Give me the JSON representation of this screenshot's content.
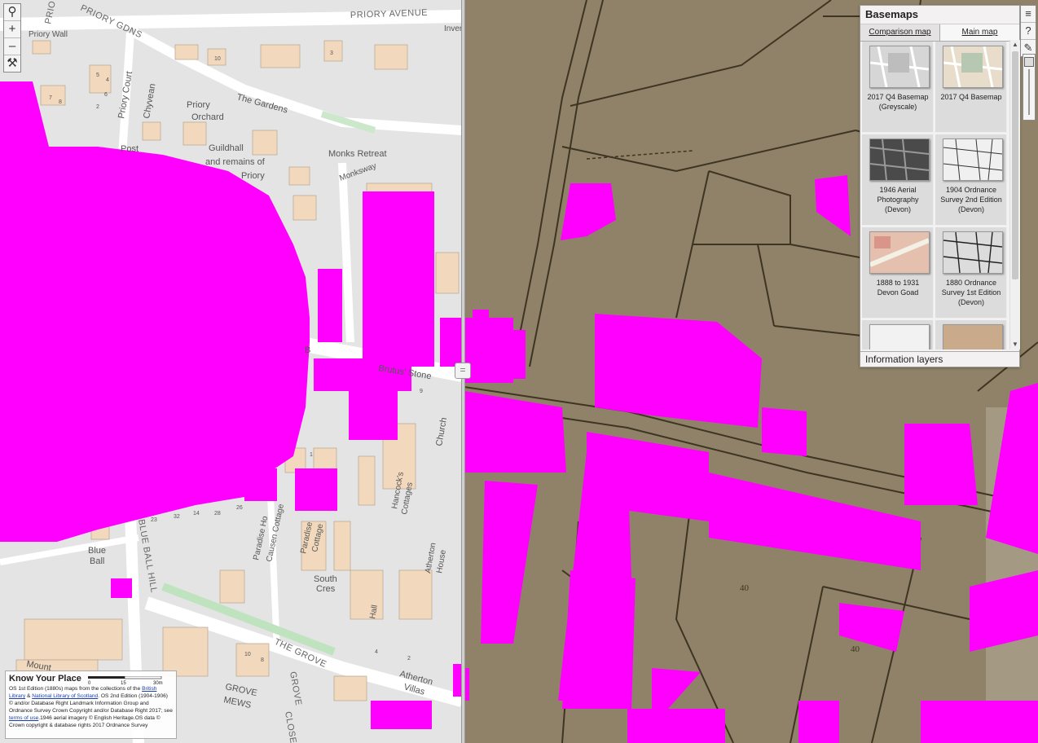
{
  "map_labels": {
    "priory_avenue": "PRIORY AVENUE",
    "priory_gdns": "PRIORY GDNS",
    "priory_corner": "PRIO",
    "priory_wall": "Priory Wall",
    "priory_court": "Priory Court",
    "chyvean": "Chyvean",
    "priory_orchard_1": "Priory",
    "priory_orchard_2": "Orchard",
    "the_gardens": "The Gardens",
    "post": "Post",
    "guildhall": "Guildhall",
    "remains": "and remains of",
    "priory": "Priory",
    "monks_retreat": "Monks Retreat",
    "monksway": "Monksway",
    "inver": "Inver",
    "brutus_stone": "Brutus' Stone",
    "b": "B",
    "church": "Church",
    "hancocks": "Hancock's",
    "cottages": "Cottages",
    "paradise_ho": "Paradise Ho",
    "causen_cottage": "Causen Cottage",
    "paradise": "Paradise",
    "cottage": "Cottage",
    "atherton": "Atherton",
    "house": "House",
    "blue": "Blue",
    "ball": "Ball",
    "blue_ball_hill": "BLUE BALL HILL",
    "south": "South",
    "cres": "Cres",
    "hall": "Hall",
    "the_grove": "THE GROVE",
    "grove": "GROVE",
    "mews": "MEWS",
    "grove_close_1": "GROVE",
    "grove_close_2": "CLOSE",
    "atherton_villas_1": "Atherton",
    "atherton_villas_2": "Villas",
    "mount": "Mount",
    "house_numbers": [
      "10",
      "3",
      "5",
      "7",
      "2",
      "4",
      "6",
      "8",
      "1",
      "9",
      "14",
      "28",
      "26",
      "23",
      "32",
      "4",
      "2",
      "10",
      "8"
    ],
    "old_map_40": "40",
    "old_map_40b": "40"
  },
  "toolbar": {
    "zoom_search_icon": "⚲",
    "zoom_in": "+",
    "zoom_out": "–",
    "measure_icon": "⚒"
  },
  "divider": {
    "handle_glyph": "="
  },
  "right_toolbar": {
    "layers_icon": "≡",
    "help_icon": "?",
    "draw_icon": "✎"
  },
  "basemaps": {
    "title": "Basemaps",
    "tabs": [
      {
        "label": "Comparison map",
        "active": true
      },
      {
        "label": "Main map",
        "active": false
      }
    ],
    "thumbs": [
      {
        "label": "2017 Q4 Basemap (Greyscale)"
      },
      {
        "label": "2017 Q4 Basemap"
      },
      {
        "label": "1946 Aerial Photography (Devon)"
      },
      {
        "label": "1904 Ordnance Survey 2nd Edition (Devon)"
      },
      {
        "label": "1888 to 1931 Devon Goad"
      },
      {
        "label": "1880 Ordnance Survey 1st Edition (Devon)"
      },
      {
        "label": ""
      },
      {
        "label": ""
      }
    ],
    "scroll_up": "▲",
    "scroll_down": "▼",
    "info_layers": "Information layers"
  },
  "attribution": {
    "title": "Know Your Place",
    "scale_ticks": [
      "0",
      "15",
      "30m"
    ],
    "line1_pre": "OS 1st Edition (1880s) maps from the collections of the ",
    "link_british_library": "British Library",
    "amp": " & ",
    "link_nls": "National Library of Scotland",
    "line1_post": ". OS 2nd Edition (1904-1906) © and/or Database Right Landmark Information Group and Ordnance Survey Crown Copyright and/or Database Right 2017; see ",
    "link_terms": "terms of use",
    "line2": ".1946 aerial imagery © English Heritage.OS data © Crown copyright & database rights 2017 Ordnance Survey"
  },
  "colors": {
    "overlay_magenta": "#ff00ff",
    "old_map_paper": "#8f8268",
    "os_building": "#f2d9bd",
    "os_ground": "#e4e4e4"
  }
}
